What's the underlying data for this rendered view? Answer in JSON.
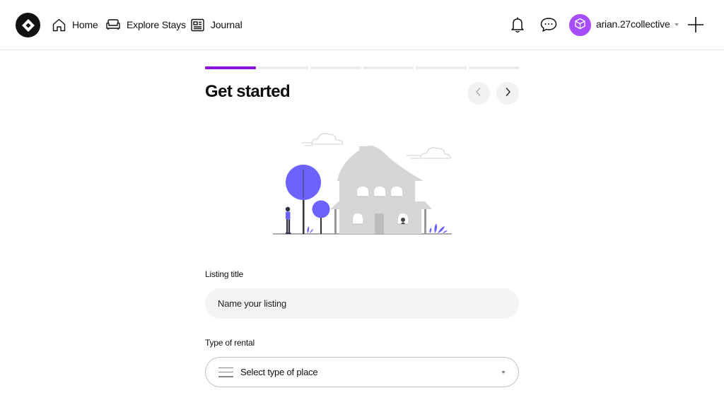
{
  "nav": {
    "home": "Home",
    "explore": "Explore Stays",
    "journal": "Journal"
  },
  "user": {
    "name": "arian.27collective"
  },
  "progress": {
    "total_steps": 6,
    "current_step": 1
  },
  "page": {
    "title": "Get started"
  },
  "form": {
    "listing_title_label": "Listing title",
    "listing_title_placeholder": "Name your listing",
    "rental_type_label": "Type of rental",
    "rental_type_placeholder": "Select type of place"
  },
  "colors": {
    "accent": "#8a12d9",
    "avatar": "#a64dff",
    "illustration_purple": "#6c63ff",
    "house_gray": "#d6d6d6"
  },
  "icons": {
    "logo": "diamond-logo-icon",
    "home": "home-icon",
    "explore": "sofa-icon",
    "journal": "newspaper-icon",
    "notifications": "bell-icon",
    "messages": "chat-bubble-icon",
    "avatar": "cube-icon",
    "create": "plus-icon",
    "prev": "chevron-left-icon",
    "next": "chevron-right-icon",
    "select": "list-lines-icon"
  }
}
